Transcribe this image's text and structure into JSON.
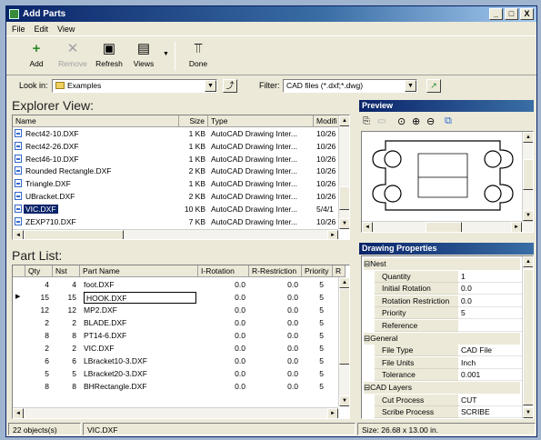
{
  "window": {
    "title": "Add Parts",
    "buttons": [
      "_",
      "□",
      "X"
    ]
  },
  "menu": [
    "File",
    "Edit",
    "View"
  ],
  "toolbar": {
    "add": "Add",
    "remove": "Remove",
    "refresh": "Refresh",
    "views": "Views",
    "done": "Done"
  },
  "lookin": {
    "label": "Look in:",
    "value": "Examples"
  },
  "filter": {
    "label": "Filter:",
    "value": "CAD files (*.dxf;*.dwg)"
  },
  "explorer": {
    "title": "Explorer View:",
    "columns": [
      "Name",
      "Size",
      "Type",
      "Modifi"
    ],
    "rows": [
      {
        "name": "Rect42-10.DXF",
        "size": "1 KB",
        "type": "AutoCAD Drawing Inter...",
        "mod": "10/26"
      },
      {
        "name": "Rect42-26.DXF",
        "size": "1 KB",
        "type": "AutoCAD Drawing Inter...",
        "mod": "10/26"
      },
      {
        "name": "Rect46-10.DXF",
        "size": "1 KB",
        "type": "AutoCAD Drawing Inter...",
        "mod": "10/26"
      },
      {
        "name": "Rounded Rectangle.DXF",
        "size": "2 KB",
        "type": "AutoCAD Drawing Inter...",
        "mod": "10/26"
      },
      {
        "name": "Triangle.DXF",
        "size": "1 KB",
        "type": "AutoCAD Drawing Inter...",
        "mod": "10/26"
      },
      {
        "name": "UBracket.DXF",
        "size": "2 KB",
        "type": "AutoCAD Drawing Inter...",
        "mod": "10/26"
      },
      {
        "name": "VIC.DXF",
        "size": "10 KB",
        "type": "AutoCAD Drawing Inter...",
        "mod": "5/4/1"
      },
      {
        "name": "ZEXP710.DXF",
        "size": "7 KB",
        "type": "AutoCAD Drawing Inter...",
        "mod": "10/26"
      }
    ]
  },
  "partlist": {
    "title": "Part List:",
    "columns": [
      "Qty",
      "Nst",
      "Part Name",
      "I-Rotation",
      "R-Restriction",
      "Priority",
      "R"
    ],
    "rows": [
      {
        "qty": "4",
        "nst": "4",
        "name": "foot.DXF",
        "irot": "0.0",
        "rres": "0.0",
        "pri": "5"
      },
      {
        "qty": "15",
        "nst": "15",
        "name": "HOOK.DXF",
        "irot": "0.0",
        "rres": "0.0",
        "pri": "5"
      },
      {
        "qty": "12",
        "nst": "12",
        "name": "MP2.DXF",
        "irot": "0.0",
        "rres": "0.0",
        "pri": "5"
      },
      {
        "qty": "2",
        "nst": "2",
        "name": "BLADE.DXF",
        "irot": "0.0",
        "rres": "0.0",
        "pri": "5"
      },
      {
        "qty": "8",
        "nst": "8",
        "name": "PT14-6.DXF",
        "irot": "0.0",
        "rres": "0.0",
        "pri": "5"
      },
      {
        "qty": "2",
        "nst": "2",
        "name": "VIC.DXF",
        "irot": "0.0",
        "rres": "0.0",
        "pri": "5"
      },
      {
        "qty": "6",
        "nst": "6",
        "name": "LBracket10-3.DXF",
        "irot": "0.0",
        "rres": "0.0",
        "pri": "5"
      },
      {
        "qty": "5",
        "nst": "5",
        "name": "LBracket20-3.DXF",
        "irot": "0.0",
        "rres": "0.0",
        "pri": "5"
      },
      {
        "qty": "8",
        "nst": "8",
        "name": "BHRectangle.DXF",
        "irot": "0.0",
        "rres": "0.0",
        "pri": "5"
      }
    ]
  },
  "preview": {
    "title": "Preview"
  },
  "properties": {
    "title": "Drawing Properties",
    "rows": [
      {
        "cat": "⊟Nest"
      },
      {
        "k": "Quantity",
        "v": "1"
      },
      {
        "k": "Initial Rotation",
        "v": "0.0"
      },
      {
        "k": "Rotation Restriction",
        "v": "0.0"
      },
      {
        "k": "Priority",
        "v": "5"
      },
      {
        "k": "Reference",
        "v": ""
      },
      {
        "cat": "⊟General"
      },
      {
        "k": "File Type",
        "v": "CAD File"
      },
      {
        "k": "File Units",
        "v": "Inch"
      },
      {
        "k": "Tolerance",
        "v": "0.001"
      },
      {
        "cat": "⊟CAD Layers"
      },
      {
        "k": "Cut Process",
        "v": "CUT"
      },
      {
        "k": "Scribe Process",
        "v": "SCRIBE"
      }
    ]
  },
  "status": {
    "count": "22 objects(s)",
    "file": "VIC.DXF",
    "size": "Size: 26.68 x 13.00 in."
  },
  "colors": {
    "title_start": "#0a246a",
    "title_end": "#a6caf0",
    "selection": "#0a246a",
    "face": "#ece9d8"
  }
}
